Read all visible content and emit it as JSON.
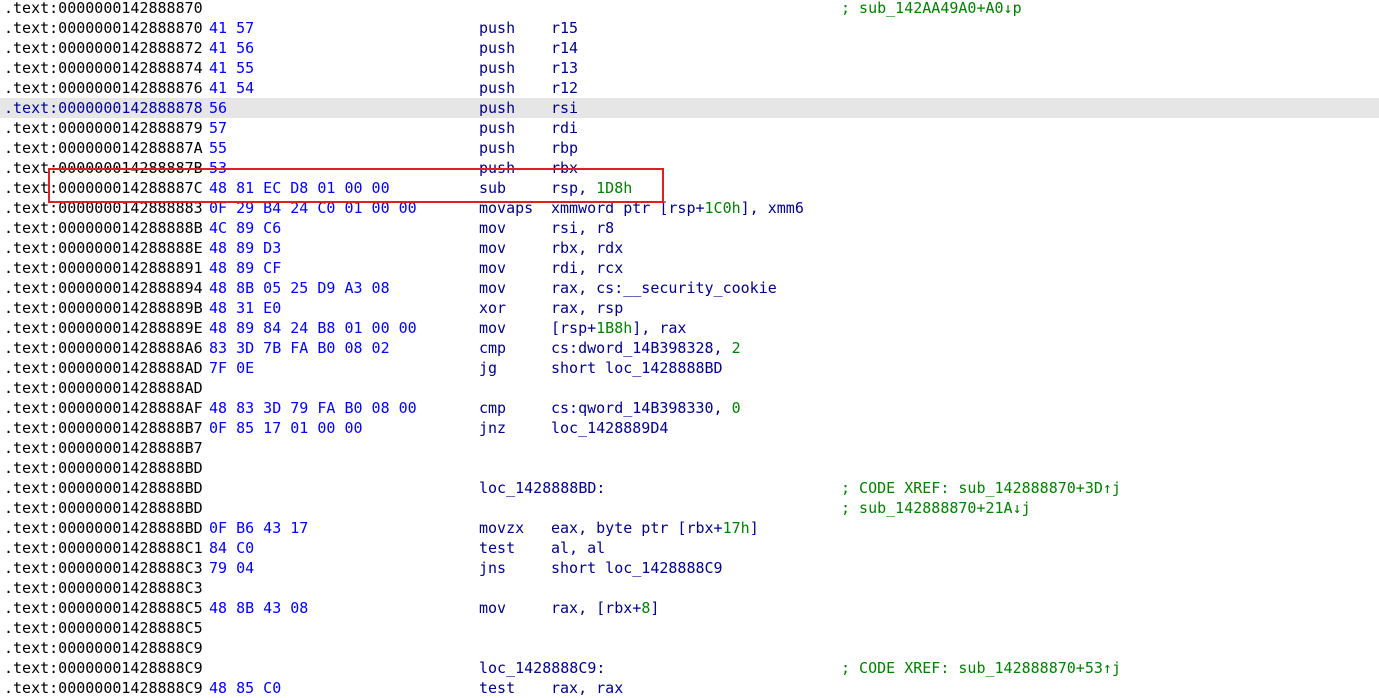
{
  "theme": {
    "address_color": "#000000",
    "bytes_color": "#0000ff",
    "mnemonic_color": "#00008b",
    "immediate_color": "#008000",
    "comment_color": "#008000",
    "current_line_bg": "#e6e6e6",
    "highlight_box": "#e02020"
  },
  "rows": [
    {
      "addr": ".text:0000000142888870",
      "bytes": "",
      "mnem": "",
      "ops": "",
      "label": "",
      "comment": "; sub_142AA49A0+A0↓p"
    },
    {
      "addr": ".text:0000000142888870",
      "bytes": "41 57",
      "mnem": "push",
      "ops": "r15",
      "label": "",
      "comment": ""
    },
    {
      "addr": ".text:0000000142888872",
      "bytes": "41 56",
      "mnem": "push",
      "ops": "r14",
      "label": "",
      "comment": ""
    },
    {
      "addr": ".text:0000000142888874",
      "bytes": "41 55",
      "mnem": "push",
      "ops": "r13",
      "label": "",
      "comment": ""
    },
    {
      "addr": ".text:0000000142888876",
      "bytes": "41 54",
      "mnem": "push",
      "ops": "r12",
      "label": "",
      "comment": ""
    },
    {
      "addr": ".text:0000000142888878",
      "bytes": "56",
      "mnem": "push",
      "ops": "rsi",
      "label": "",
      "comment": "",
      "current": true
    },
    {
      "addr": ".text:0000000142888879",
      "bytes": "57",
      "mnem": "push",
      "ops": "rdi",
      "label": "",
      "comment": ""
    },
    {
      "addr": ".text:000000014288887A",
      "bytes": "55",
      "mnem": "push",
      "ops": "rbp",
      "label": "",
      "comment": ""
    },
    {
      "addr": ".text:000000014288887B",
      "bytes": "53",
      "mnem": "push",
      "ops": "rbx",
      "label": "",
      "comment": ""
    },
    {
      "addr": ".text:000000014288887C",
      "bytes": "48 81 EC D8 01 00 00",
      "mnem": "sub",
      "ops": "rsp, ",
      "num": "1D8h",
      "ops_after": "",
      "label": "",
      "comment": "",
      "highlighted": true
    },
    {
      "addr": ".text:0000000142888883",
      "bytes": "0F 29 B4 24 C0 01 00 00",
      "mnem": "movaps",
      "ops": "xmmword ptr [rsp+",
      "num": "1C0h",
      "ops_after": "], xmm6",
      "label": "",
      "comment": ""
    },
    {
      "addr": ".text:000000014288888B",
      "bytes": "4C 89 C6",
      "mnem": "mov",
      "ops": "rsi, r8",
      "label": "",
      "comment": ""
    },
    {
      "addr": ".text:000000014288888E",
      "bytes": "48 89 D3",
      "mnem": "mov",
      "ops": "rbx, rdx",
      "label": "",
      "comment": ""
    },
    {
      "addr": ".text:0000000142888891",
      "bytes": "48 89 CF",
      "mnem": "mov",
      "ops": "rdi, rcx",
      "label": "",
      "comment": ""
    },
    {
      "addr": ".text:0000000142888894",
      "bytes": "48 8B 05 25 D9 A3 08",
      "mnem": "mov",
      "ops": "rax, cs:__security_cookie",
      "label": "",
      "comment": ""
    },
    {
      "addr": ".text:000000014288889B",
      "bytes": "48 31 E0",
      "mnem": "xor",
      "ops": "rax, rsp",
      "label": "",
      "comment": ""
    },
    {
      "addr": ".text:000000014288889E",
      "bytes": "48 89 84 24 B8 01 00 00",
      "mnem": "mov",
      "ops": "[rsp+",
      "num": "1B8h",
      "ops_after": "], rax",
      "label": "",
      "comment": ""
    },
    {
      "addr": ".text:00000001428888A6",
      "bytes": "83 3D 7B FA B0 08 02",
      "mnem": "cmp",
      "ops": "cs:dword_14B398328, ",
      "num": "2",
      "ops_after": "",
      "label": "",
      "comment": ""
    },
    {
      "addr": ".text:00000001428888AD",
      "bytes": "7F 0E",
      "mnem": "jg",
      "ops": "short loc_1428888BD",
      "label": "",
      "comment": ""
    },
    {
      "addr": ".text:00000001428888AD",
      "bytes": "",
      "mnem": "",
      "ops": "",
      "label": "",
      "comment": ""
    },
    {
      "addr": ".text:00000001428888AF",
      "bytes": "48 83 3D 79 FA B0 08 00",
      "mnem": "cmp",
      "ops": "cs:qword_14B398330, ",
      "num": "0",
      "ops_after": "",
      "label": "",
      "comment": ""
    },
    {
      "addr": ".text:00000001428888B7",
      "bytes": "0F 85 17 01 00 00",
      "mnem": "jnz",
      "ops": "loc_1428889D4",
      "label": "",
      "comment": ""
    },
    {
      "addr": ".text:00000001428888B7",
      "bytes": "",
      "mnem": "",
      "ops": "",
      "label": "",
      "comment": ""
    },
    {
      "addr": ".text:00000001428888BD",
      "bytes": "",
      "mnem": "",
      "ops": "",
      "label": "",
      "comment": ""
    },
    {
      "addr": ".text:00000001428888BD",
      "bytes": "",
      "mnem": "",
      "ops": "",
      "label": "loc_1428888BD:",
      "comment": "; CODE XREF: sub_142888870+3D↑j"
    },
    {
      "addr": ".text:00000001428888BD",
      "bytes": "",
      "mnem": "",
      "ops": "",
      "label": "",
      "comment": "; sub_142888870+21A↓j"
    },
    {
      "addr": ".text:00000001428888BD",
      "bytes": "0F B6 43 17",
      "mnem": "movzx",
      "ops": "eax, byte ptr [rbx+",
      "num": "17h",
      "ops_after": "]",
      "label": "",
      "comment": ""
    },
    {
      "addr": ".text:00000001428888C1",
      "bytes": "84 C0",
      "mnem": "test",
      "ops": "al, al",
      "label": "",
      "comment": ""
    },
    {
      "addr": ".text:00000001428888C3",
      "bytes": "79 04",
      "mnem": "jns",
      "ops": "short loc_1428888C9",
      "label": "",
      "comment": ""
    },
    {
      "addr": ".text:00000001428888C3",
      "bytes": "",
      "mnem": "",
      "ops": "",
      "label": "",
      "comment": ""
    },
    {
      "addr": ".text:00000001428888C5",
      "bytes": "48 8B 43 08",
      "mnem": "mov",
      "ops": "rax, [rbx+",
      "num": "8",
      "ops_after": "]",
      "label": "",
      "comment": ""
    },
    {
      "addr": ".text:00000001428888C5",
      "bytes": "",
      "mnem": "",
      "ops": "",
      "label": "",
      "comment": ""
    },
    {
      "addr": ".text:00000001428888C9",
      "bytes": "",
      "mnem": "",
      "ops": "",
      "label": "",
      "comment": ""
    },
    {
      "addr": ".text:00000001428888C9",
      "bytes": "",
      "mnem": "",
      "ops": "",
      "label": "loc_1428888C9:",
      "comment": "; CODE XREF: sub_142888870+53↑j"
    },
    {
      "addr": ".text:00000001428888C9",
      "bytes": "48 85 C0",
      "mnem": "test",
      "ops": "rax, rax",
      "label": "",
      "comment": ""
    }
  ]
}
